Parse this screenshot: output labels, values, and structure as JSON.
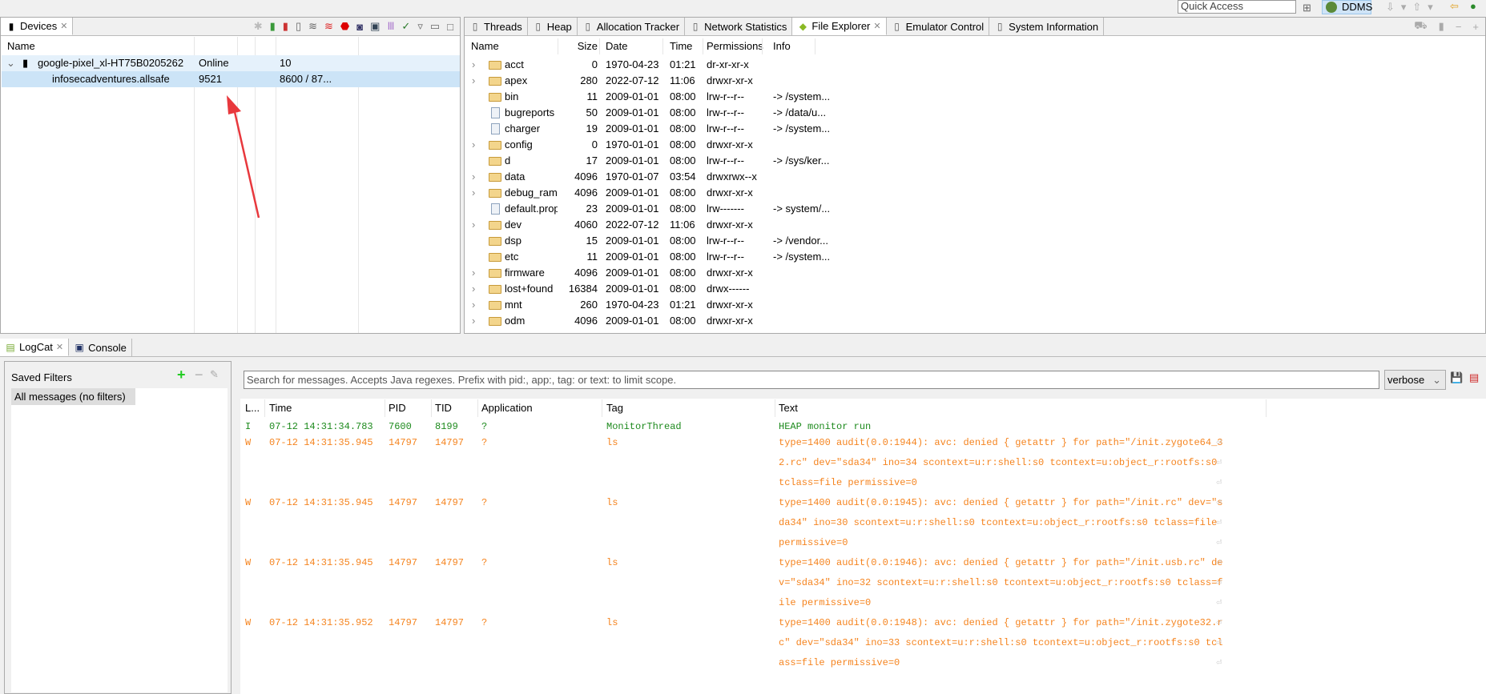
{
  "topbar": {
    "quick_access": "Quick Access",
    "perspective": "DDMS"
  },
  "devices": {
    "tab": "Devices",
    "header": "Name",
    "rows": [
      {
        "name": "google-pixel_xl-HT75B0205262",
        "c2": "Online",
        "c3": "10",
        "kind": "device"
      },
      {
        "name": "infosecadventures.allsafe",
        "c2": "9521",
        "c3": "8600 / 87...",
        "kind": "process"
      }
    ]
  },
  "explorer": {
    "tabs": [
      {
        "label": "Threads",
        "icon": "threads-icon"
      },
      {
        "label": "Heap",
        "icon": "heap-icon"
      },
      {
        "label": "Allocation Tracker",
        "icon": "allocation-icon"
      },
      {
        "label": "Network Statistics",
        "icon": "wifi-icon"
      },
      {
        "label": "File Explorer",
        "icon": "android-icon",
        "active": true
      },
      {
        "label": "Emulator Control",
        "icon": "emulator-icon"
      },
      {
        "label": "System Information",
        "icon": "window-icon"
      }
    ],
    "columns": [
      "Name",
      "Size",
      "Date",
      "Time",
      "Permissions",
      "Info"
    ],
    "rows": [
      [
        "acct",
        "0",
        "1970-04-23",
        "01:21",
        "dr-xr-xr-x",
        "",
        "d"
      ],
      [
        "apex",
        "280",
        "2022-07-12",
        "11:06",
        "drwxr-xr-x",
        "",
        "d"
      ],
      [
        "bin",
        "11",
        "2009-01-01",
        "08:00",
        "lrw-r--r--",
        "-> /system...",
        "l"
      ],
      [
        "bugreports",
        "50",
        "2009-01-01",
        "08:00",
        "lrw-r--r--",
        "-> /data/u...",
        "f"
      ],
      [
        "charger",
        "19",
        "2009-01-01",
        "08:00",
        "lrw-r--r--",
        "-> /system...",
        "f"
      ],
      [
        "config",
        "0",
        "1970-01-01",
        "08:00",
        "drwxr-xr-x",
        "",
        "d"
      ],
      [
        "d",
        "17",
        "2009-01-01",
        "08:00",
        "lrw-r--r--",
        "-> /sys/ker...",
        "l"
      ],
      [
        "data",
        "4096",
        "1970-01-07",
        "03:54",
        "drwxrwx--x",
        "",
        "d"
      ],
      [
        "debug_ramdisk",
        "4096",
        "2009-01-01",
        "08:00",
        "drwxr-xr-x",
        "",
        "d"
      ],
      [
        "default.prop",
        "23",
        "2009-01-01",
        "08:00",
        "lrw-------",
        "-> system/...",
        "f"
      ],
      [
        "dev",
        "4060",
        "2022-07-12",
        "11:06",
        "drwxr-xr-x",
        "",
        "d"
      ],
      [
        "dsp",
        "15",
        "2009-01-01",
        "08:00",
        "lrw-r--r--",
        "-> /vendor...",
        "l"
      ],
      [
        "etc",
        "11",
        "2009-01-01",
        "08:00",
        "lrw-r--r--",
        "-> /system...",
        "l"
      ],
      [
        "firmware",
        "4096",
        "2009-01-01",
        "08:00",
        "drwxr-xr-x",
        "",
        "d"
      ],
      [
        "lost+found",
        "16384",
        "2009-01-01",
        "08:00",
        "drwx------",
        "",
        "d"
      ],
      [
        "mnt",
        "260",
        "1970-04-23",
        "01:21",
        "drwxr-xr-x",
        "",
        "d"
      ],
      [
        "odm",
        "4096",
        "2009-01-01",
        "08:00",
        "drwxr-xr-x",
        "",
        "d"
      ]
    ]
  },
  "bottom": {
    "tabs": [
      "LogCat",
      "Console"
    ],
    "saved_filters": "Saved Filters",
    "filter_item": "All messages (no filters)",
    "search_placeholder": "Search for messages. Accepts Java regexes. Prefix with pid:, app:, tag: or text: to limit scope.",
    "level": "verbose",
    "columns": [
      "L...",
      "Time",
      "PID",
      "TID",
      "Application",
      "Tag",
      "Text"
    ],
    "colors": {
      "info": "#1d8a1d",
      "warn": "#f5841f"
    },
    "rows": [
      {
        "level": "I",
        "time": "07-12 14:31:34.783",
        "pid": "7600",
        "tid": "8199",
        "app": "?",
        "tag": "MonitorThread",
        "text": [
          "HEAP monitor run"
        ]
      },
      {
        "level": "W",
        "time": "07-12 14:31:35.945",
        "pid": "14797",
        "tid": "14797",
        "app": "?",
        "tag": "ls",
        "text": [
          "type=1400 audit(0.0:1944): avc: denied { getattr } for path=\"/init.zygote64_3",
          "2.rc\" dev=\"sda34\" ino=34 scontext=u:r:shell:s0 tcontext=u:object_r:rootfs:s0",
          "tclass=file permissive=0"
        ]
      },
      {
        "level": "W",
        "time": "07-12 14:31:35.945",
        "pid": "14797",
        "tid": "14797",
        "app": "?",
        "tag": "ls",
        "text": [
          "type=1400 audit(0.0:1945): avc: denied { getattr } for path=\"/init.rc\" dev=\"s",
          "da34\" ino=30 scontext=u:r:shell:s0 tcontext=u:object_r:rootfs:s0 tclass=file",
          "permissive=0"
        ]
      },
      {
        "level": "W",
        "time": "07-12 14:31:35.945",
        "pid": "14797",
        "tid": "14797",
        "app": "?",
        "tag": "ls",
        "text": [
          "type=1400 audit(0.0:1946): avc: denied { getattr } for path=\"/init.usb.rc\" de",
          "v=\"sda34\" ino=32 scontext=u:r:shell:s0 tcontext=u:object_r:rootfs:s0 tclass=f",
          "ile permissive=0"
        ]
      },
      {
        "level": "W",
        "time": "07-12 14:31:35.952",
        "pid": "14797",
        "tid": "14797",
        "app": "?",
        "tag": "ls",
        "text": [
          "type=1400 audit(0.0:1948): avc: denied { getattr } for path=\"/init.zygote32.r",
          "c\" dev=\"sda34\" ino=33 scontext=u:r:shell:s0 tcontext=u:object_r:rootfs:s0 tcl",
          "ass=file permissive=0"
        ]
      }
    ]
  }
}
